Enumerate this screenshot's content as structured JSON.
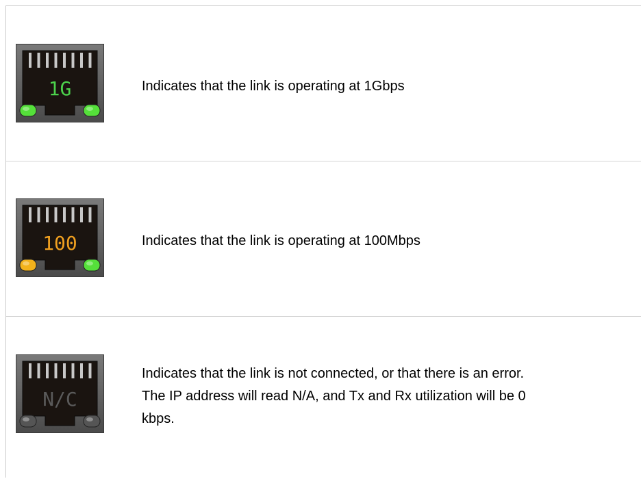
{
  "rows": [
    {
      "icon": "ethernet-port-1g-icon",
      "port_label": "1G",
      "label_color": "#4cd24c",
      "left_led_color": "#55e03a",
      "right_led_color": "#55e03a",
      "lines": [
        "Indicates that the link is operating at 1Gbps"
      ]
    },
    {
      "icon": "ethernet-port-100m-icon",
      "port_label": "100",
      "label_color": "#f0a020",
      "left_led_color": "#f2b21c",
      "right_led_color": "#55e03a",
      "lines": [
        "Indicates that the link is operating at 100Mbps"
      ]
    },
    {
      "icon": "ethernet-port-nc-icon",
      "port_label": "N/C",
      "label_color": "#5a5a5a",
      "left_led_color": "#555555",
      "right_led_color": "#555555",
      "lines": [
        "Indicates that the link is not connected, or that there is an error.",
        "The IP address will read N/A, and Tx and Rx utilization will be 0",
        "kbps."
      ]
    }
  ]
}
